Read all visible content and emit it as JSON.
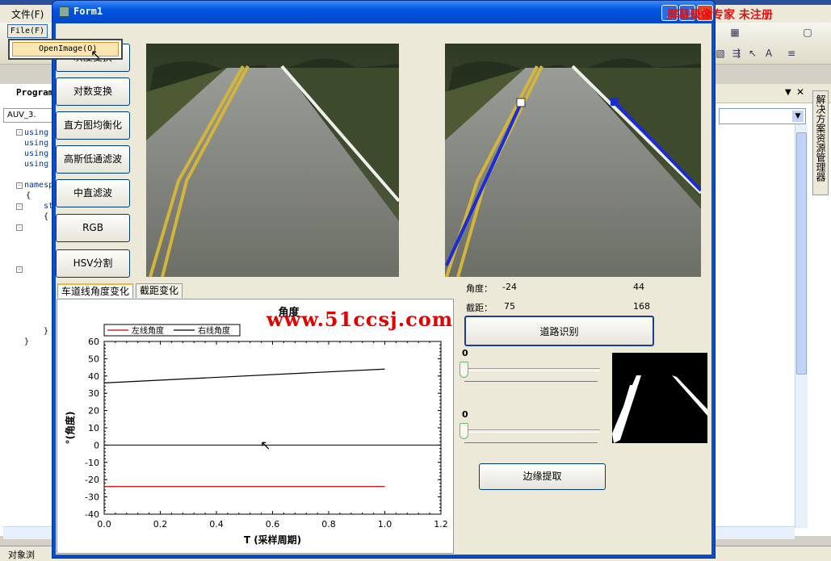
{
  "ide": {
    "menu_file": "文件(F)",
    "left_tab": "Program",
    "file_tab": "AUV_3.",
    "code_lines": [
      "using",
      "using",
      "using",
      "using",
      "namesp",
      "{",
      "st",
      "{",
      "}",
      "}"
    ],
    "side_tab_label": "解决方案资源管理器",
    "status_text": "对象浏"
  },
  "watermark_red": "屏幕录像专家 未注册",
  "form": {
    "title": "Form1",
    "menu_file": "File(F)",
    "menu_item": "OpenImage(O)",
    "buttons": [
      "灰度变换",
      "对数变换",
      "直方图均衡化",
      "高斯低通滤波",
      "中直滤波",
      "RGB",
      "HSV分割"
    ],
    "tabs": [
      "车道线角度变化",
      "截距变化"
    ],
    "web_watermark": "www.51ccsj.com",
    "angle_label": "角度：",
    "angle_left": "-24",
    "angle_right": "44",
    "intercept_label": "截距：",
    "intercept_left": "75",
    "intercept_right": "168",
    "road_detect_button": "道路识别",
    "slider1_value": "0",
    "slider2_value": "0",
    "edge_extract_button": "边缘提取"
  },
  "chart_data": {
    "type": "line",
    "title": "角度",
    "xlabel": "T (采样周期)",
    "ylabel": "°(角度)",
    "xlim": [
      0.0,
      1.2
    ],
    "ylim": [
      -40,
      60
    ],
    "xticks": [
      "0.0",
      "0.2",
      "0.4",
      "0.6",
      "0.8",
      "1.0",
      "1.2"
    ],
    "yticks": [
      "60",
      "50",
      "40",
      "30",
      "20",
      "10",
      "0",
      "-10",
      "-20",
      "-30",
      "-40"
    ],
    "legend_position": "top-left",
    "series": [
      {
        "name": "左线角度",
        "color": "#cc0000",
        "x": [
          0.0,
          1.0
        ],
        "y": [
          -24,
          -24
        ]
      },
      {
        "name": "右线角度",
        "color": "#000000",
        "x": [
          0.0,
          1.0
        ],
        "y": [
          36,
          44
        ]
      }
    ],
    "zero_line": true
  }
}
